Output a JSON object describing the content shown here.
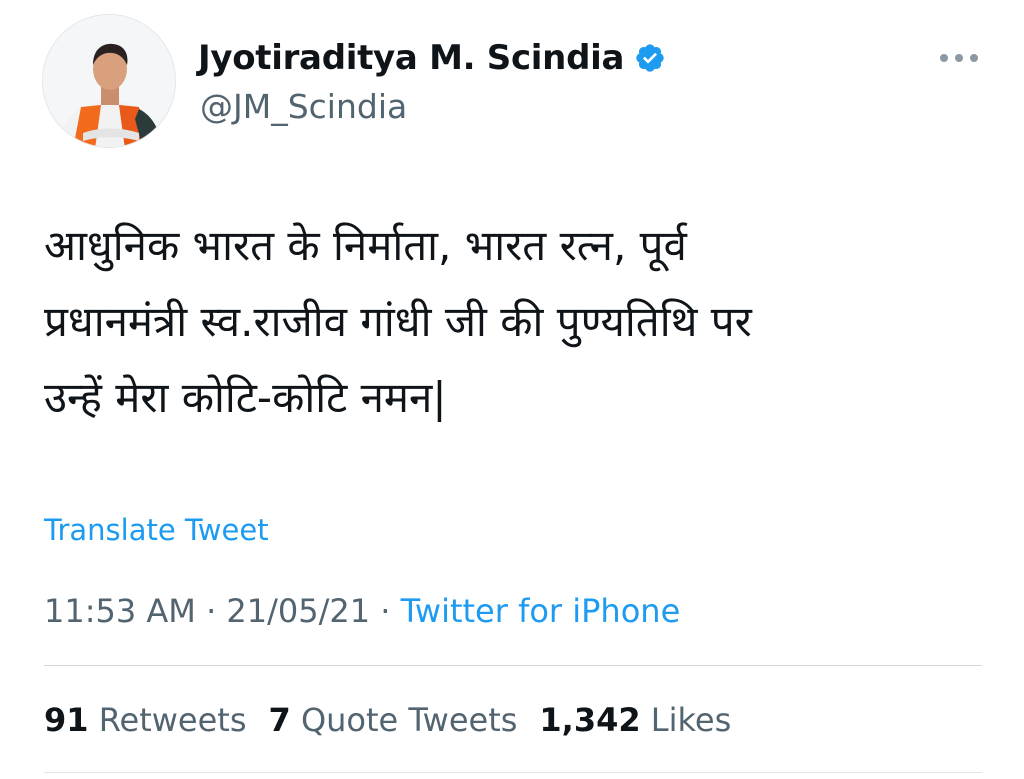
{
  "author": {
    "display_name": "Jyotiraditya M. Scindia",
    "handle": "@JM_Scindia",
    "verified": true,
    "avatar_icon": "profile-photo"
  },
  "tweet": {
    "text_lines": [
      "आधुनिक भारत के निर्माता, भारत रत्न, पूर्व",
      "प्रधानमंत्री स्व.राजीव गांधी जी की पुण्यतिथि पर",
      "उन्हें मेरा कोटि-कोटि नमन|"
    ],
    "translate_label": "Translate Tweet"
  },
  "meta": {
    "time": "11:53 AM",
    "separator": "·",
    "date": "21/05/21",
    "source": "Twitter for iPhone"
  },
  "stats": {
    "retweets_count": "91",
    "retweets_label": "Retweets",
    "quotes_count": "7",
    "quotes_label": "Quote Tweets",
    "likes_count": "1,342",
    "likes_label": "Likes"
  },
  "colors": {
    "accent": "#1d9bf0",
    "text_primary": "#0f1419",
    "text_secondary": "#536471",
    "divider": "#cfd9de"
  }
}
